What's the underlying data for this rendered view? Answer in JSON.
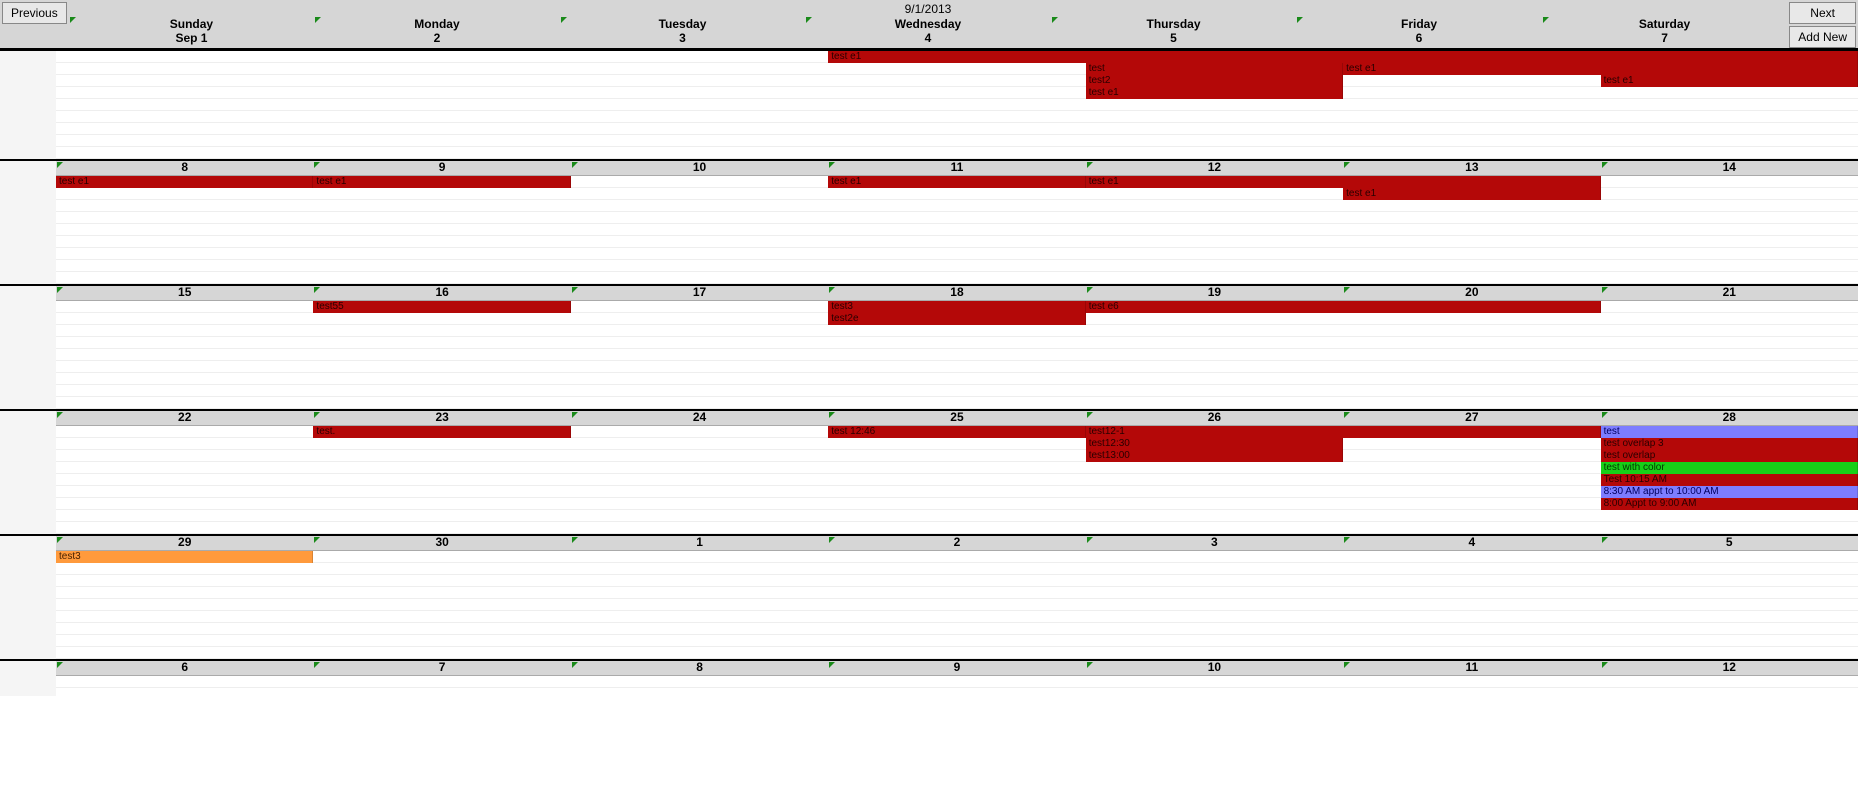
{
  "header": {
    "previous_label": "Previous",
    "next_label": "Next",
    "addnew_label": "Add New",
    "current_date": "9/1/2013"
  },
  "day_names": [
    "Sunday",
    "Monday",
    "Tuesday",
    "Wednesday",
    "Thursday",
    "Friday",
    "Saturday"
  ],
  "first_row_dates": [
    "Sep 1",
    "2",
    "3",
    "4",
    "5",
    "6",
    "7"
  ],
  "weeks": [
    {
      "dates": [
        "Sep 1",
        "2",
        "3",
        "4",
        "5",
        "6",
        "7"
      ],
      "is_header_row": true
    },
    {
      "dates": [
        "8",
        "9",
        "10",
        "11",
        "12",
        "13",
        "14"
      ]
    },
    {
      "dates": [
        "15",
        "16",
        "17",
        "18",
        "19",
        "20",
        "21"
      ]
    },
    {
      "dates": [
        "22",
        "23",
        "24",
        "25",
        "26",
        "27",
        "28"
      ]
    },
    {
      "dates": [
        "29",
        "30",
        "1",
        "2",
        "3",
        "4",
        "5"
      ]
    },
    {
      "dates": [
        "6",
        "7",
        "8",
        "9",
        "10",
        "11",
        "12"
      ]
    }
  ],
  "events": {
    "w0": [
      {
        "label": "test e1",
        "start": 3,
        "span": 4,
        "row": 0,
        "color": "red"
      },
      {
        "label": "test",
        "start": 4,
        "span": 1,
        "row": 1,
        "color": "red"
      },
      {
        "label": "test2",
        "start": 4,
        "span": 1,
        "row": 2,
        "color": "red"
      },
      {
        "label": "test e1",
        "start": 4,
        "span": 1,
        "row": 3,
        "color": "red"
      },
      {
        "label": "test e1",
        "start": 5,
        "span": 2,
        "row": 1,
        "color": "red"
      },
      {
        "label": "test e1",
        "start": 6,
        "span": 1,
        "row": 2,
        "color": "red"
      }
    ],
    "w1": [
      {
        "label": "test e1",
        "start": 0,
        "span": 1,
        "row": 0,
        "color": "red"
      },
      {
        "label": "test e1",
        "start": 1,
        "span": 1,
        "row": 0,
        "color": "red"
      },
      {
        "label": "test e1",
        "start": 3,
        "span": 1,
        "row": 0,
        "color": "red"
      },
      {
        "label": "test e1",
        "start": 4,
        "span": 2,
        "row": 0,
        "color": "red"
      },
      {
        "label": "test e1",
        "start": 5,
        "span": 1,
        "row": 1,
        "color": "red"
      }
    ],
    "w2": [
      {
        "label": "test55",
        "start": 1,
        "span": 1,
        "row": 0,
        "color": "red"
      },
      {
        "label": "test3",
        "start": 3,
        "span": 1,
        "row": 0,
        "color": "red"
      },
      {
        "label": "test2e",
        "start": 3,
        "span": 1,
        "row": 1,
        "color": "red"
      },
      {
        "label": "test e6",
        "start": 4,
        "span": 2,
        "row": 0,
        "color": "red"
      }
    ],
    "w3": [
      {
        "label": "test.",
        "start": 1,
        "span": 1,
        "row": 0,
        "color": "red"
      },
      {
        "label": "test 12:46",
        "start": 3,
        "span": 1,
        "row": 0,
        "color": "red"
      },
      {
        "label": "test12-1",
        "start": 4,
        "span": 2,
        "row": 0,
        "color": "red"
      },
      {
        "label": "test12:30",
        "start": 4,
        "span": 1,
        "row": 1,
        "color": "red"
      },
      {
        "label": "test13:00",
        "start": 4,
        "span": 1,
        "row": 2,
        "color": "red"
      },
      {
        "label": "test",
        "start": 6,
        "span": 1,
        "row": 0,
        "color": "blue"
      },
      {
        "label": "test overlap 3",
        "start": 6,
        "span": 1,
        "row": 1,
        "color": "red"
      },
      {
        "label": "test overlap",
        "start": 6,
        "span": 1,
        "row": 2,
        "color": "red"
      },
      {
        "label": "test with color",
        "start": 6,
        "span": 1,
        "row": 3,
        "color": "green"
      },
      {
        "label": "Test 10:15 AM",
        "start": 6,
        "span": 1,
        "row": 4,
        "color": "red"
      },
      {
        "label": "8:30 AM appt to 10:00 AM",
        "start": 6,
        "span": 1,
        "row": 5,
        "color": "blue"
      },
      {
        "label": "8:00 Appt to 9:00 AM",
        "start": 6,
        "span": 1,
        "row": 6,
        "color": "red"
      }
    ],
    "w4": [
      {
        "label": "test3",
        "start": 0,
        "span": 1,
        "row": 0,
        "color": "orange"
      }
    ],
    "w5": []
  }
}
